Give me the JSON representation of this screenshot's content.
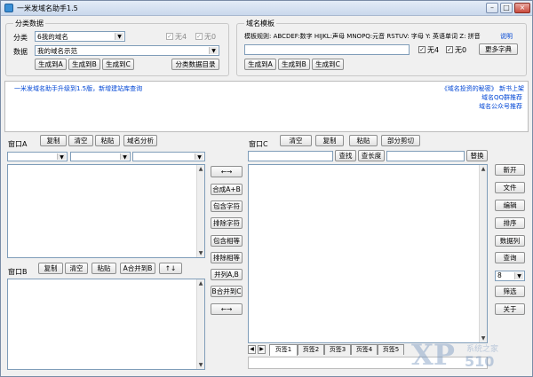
{
  "window": {
    "title": "一米发域名助手1.5",
    "min": "–",
    "max": "□",
    "close": "×"
  },
  "category_group": {
    "legend": "分类数据",
    "category_label": "分类",
    "category_value": "6我的域名",
    "chk4_label": "无4",
    "chk0_label": "无0",
    "data_label": "数据",
    "data_value": "我的域名示范",
    "gen_a": "生成到A",
    "gen_b": "生成到B",
    "gen_c": "生成到C",
    "catalog": "分类数据目录"
  },
  "template_group": {
    "legend": "域名模板",
    "rule_text": "模板规则: ABCDEF:数字 HIJKL:声母 MNOPQ:元音 RSTUV: 字母 Y: 英语单词 Z: 拼音",
    "help": "说明",
    "input_value": "",
    "chk4_label": "无4",
    "chk0_label": "无0",
    "more_dict": "更多字典",
    "gen_a": "生成到A",
    "gen_b": "生成到B",
    "gen_c": "生成到C"
  },
  "banner": {
    "notice": "一米发域名助手升级到1.5版，新增建站库查询",
    "link1_a": "《域名投资的秘密》",
    "link1_b": "新书上架",
    "link2": "域名QQ群推荐",
    "link3": "域名公众号推荐"
  },
  "window_a": {
    "label": "窗口A",
    "copy": "复制",
    "clear": "清空",
    "paste": "粘贴",
    "analysis": "域名分析"
  },
  "window_b": {
    "label": "窗口B",
    "copy": "复制",
    "clear": "清空",
    "paste": "粘贴",
    "merge": "A合并到B",
    "sort": "↑↓"
  },
  "middle": {
    "swap_top": "←→",
    "merge_ab": "合成A+B",
    "contains_char": "包含字符",
    "exclude_char": "排除字符",
    "contains_same": "包含相等",
    "exclude_same": "排除相等",
    "union_ab": "并列A,B",
    "b_merge_c": "B合并到C",
    "swap_bottom": "←→"
  },
  "window_c": {
    "label": "窗口C",
    "clear": "清空",
    "copy": "复制",
    "paste": "粘贴",
    "part_cut": "部分剪切",
    "find": "查找",
    "find_len": "查长度",
    "replace": "替换",
    "tabs": [
      "页签1",
      "页签2",
      "页签3",
      "页签4",
      "页签5"
    ]
  },
  "right": {
    "new": "新开",
    "file": "文件",
    "edit": "编辑",
    "sort": "排序",
    "columns": "数据列",
    "query": "查询",
    "select_value": "8",
    "pick": "筛选",
    "close": "关于"
  },
  "watermark": {
    "xp": "XP",
    "site": "系统之家",
    "num": "510"
  },
  "colors": {
    "link": "#0046d5",
    "title_bar": "#c9d8ec"
  }
}
